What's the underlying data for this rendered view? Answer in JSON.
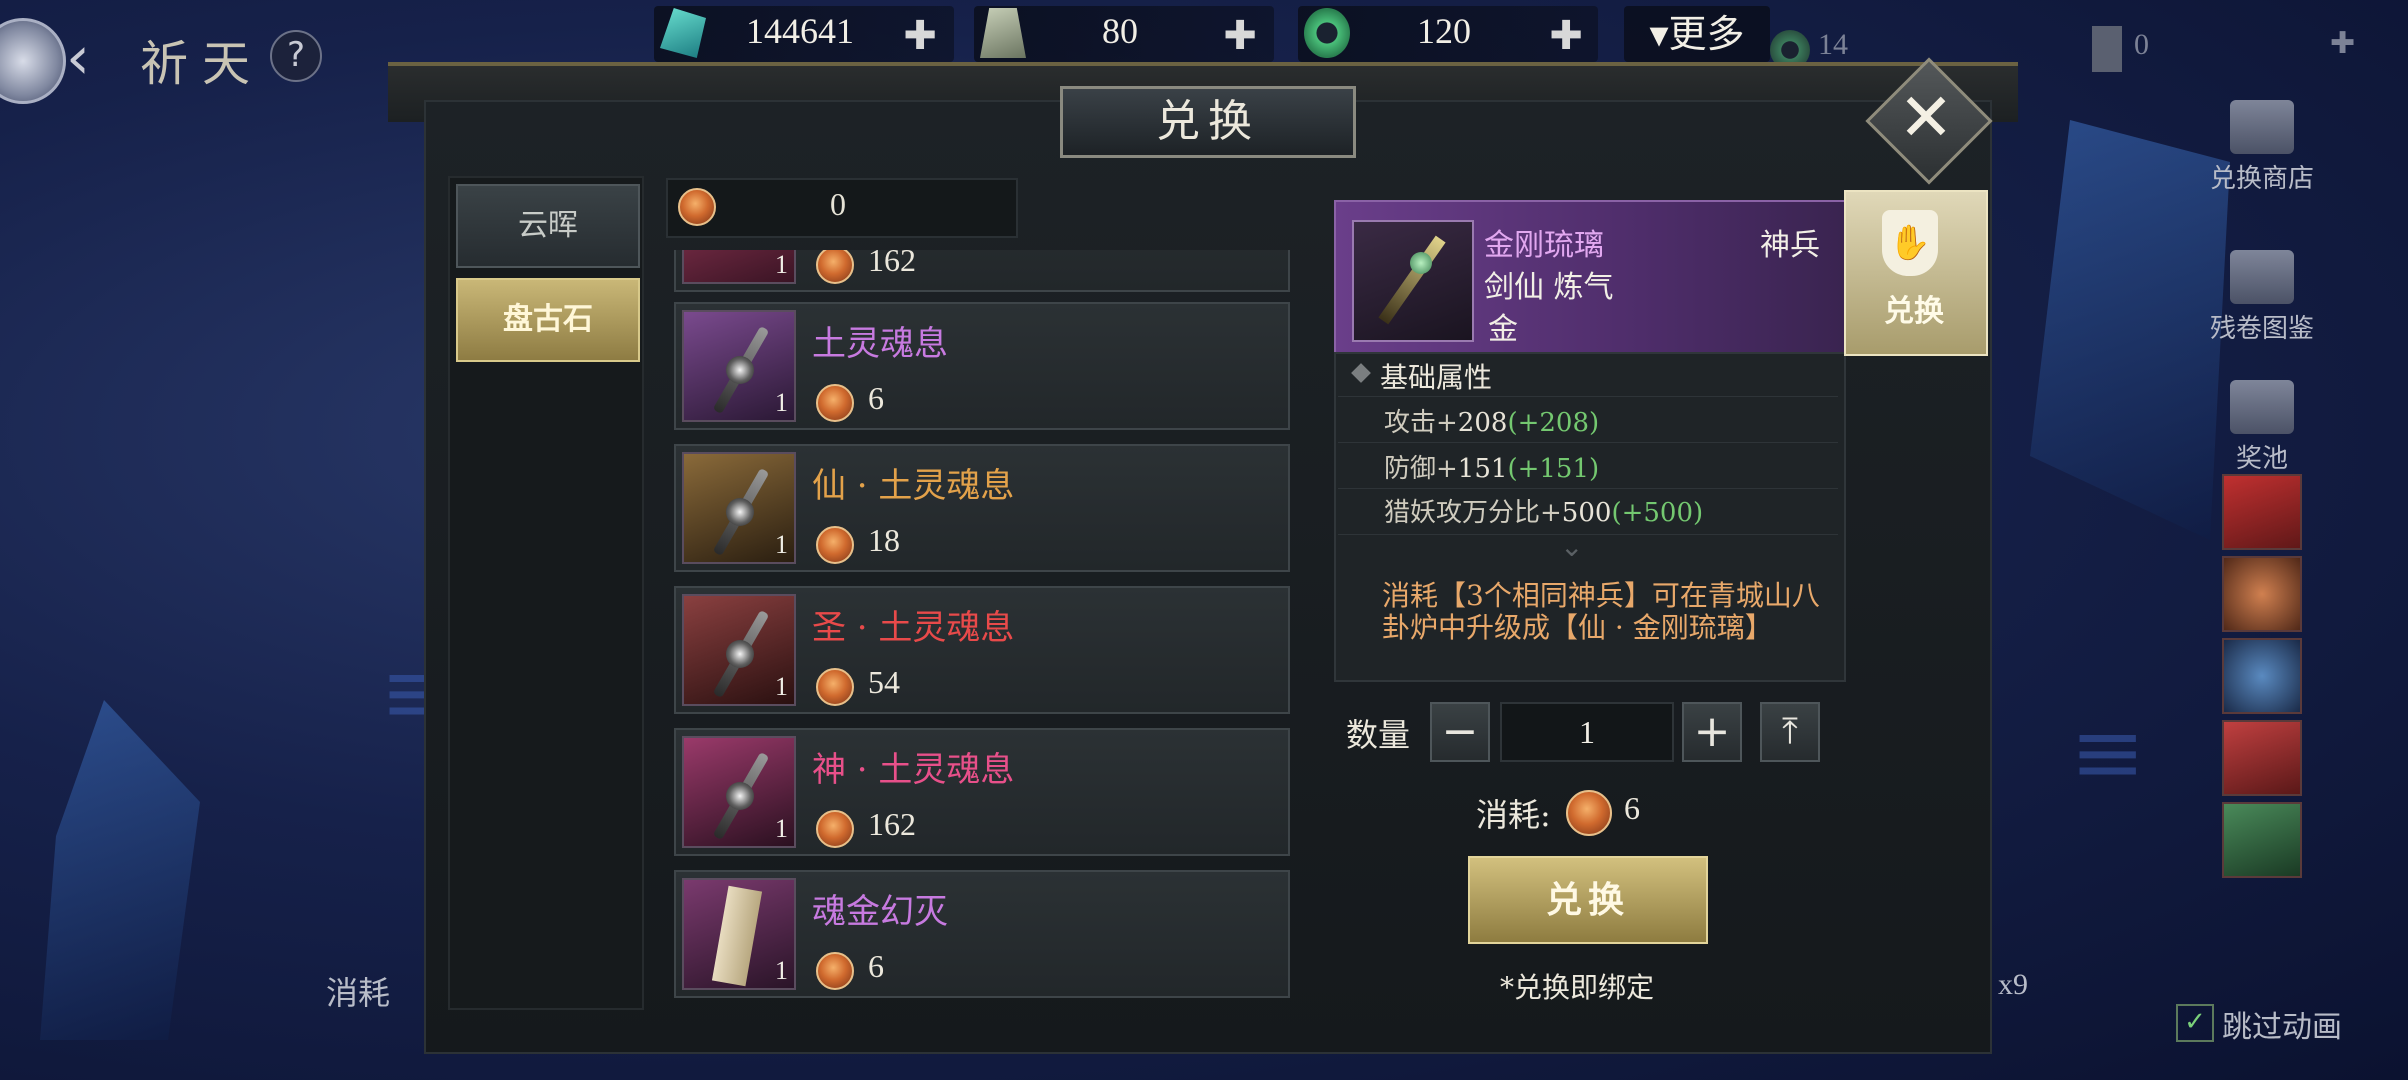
{
  "top_bar": {
    "title": "祈天",
    "help": "?",
    "resources": [
      {
        "icon": "jade-crystal-icon",
        "value": "144641"
      },
      {
        "icon": "token-card-icon",
        "value": "80"
      },
      {
        "icon": "green-ring-icon",
        "value": "120"
      }
    ],
    "more_label": "更多",
    "dim_resources": [
      "14",
      "0"
    ]
  },
  "panel": {
    "title": "兑换",
    "categories": [
      {
        "label": "云晖",
        "active": false
      },
      {
        "label": "盘古石",
        "active": true
      }
    ],
    "currency_count": "0",
    "items": [
      {
        "name": "",
        "qty": "1",
        "cost": "162",
        "name_color": "#d85a9c",
        "bg": "#7a2a4a",
        "partial": true
      },
      {
        "name": "土灵魂息",
        "qty": "1",
        "cost": "6",
        "name_color": "#c77ae0",
        "bg": "#4e2a5e"
      },
      {
        "name": "仙 · 土灵魂息",
        "qty": "1",
        "cost": "18",
        "name_color": "#e3a24a",
        "bg": "#5a4226"
      },
      {
        "name": "圣 · 土灵魂息",
        "qty": "1",
        "cost": "54",
        "name_color": "#e84a4a",
        "bg": "#5e2626"
      },
      {
        "name": "神 · 土灵魂息",
        "qty": "1",
        "cost": "162",
        "name_color": "#e8508a",
        "bg": "#6a2240"
      },
      {
        "name": "魂金幻灭",
        "qty": "1",
        "cost": "6",
        "name_color": "#c77ae0",
        "bg": "#4e2a5e"
      }
    ]
  },
  "detail": {
    "name": "金刚琉璃",
    "type": "神兵",
    "subtitle": "剑仙 炼气",
    "element": "金",
    "attr_header": "基础属性",
    "attrs": [
      {
        "label": "攻击+",
        "value": "208",
        "bonus": "(+208)"
      },
      {
        "label": "防御+",
        "value": "151",
        "bonus": "(+151)"
      },
      {
        "label": "猎妖攻万分比+",
        "value": "500",
        "bonus": "(+500)"
      }
    ],
    "description": "消耗【3个相同神兵】可在青城山八卦炉中升级成【仙 · 金刚琉璃】",
    "side_tab": "兑换",
    "qty_label": "数量",
    "qty_value": "1",
    "cost_label": "消耗:",
    "cost_value": "6",
    "exchange_label": "兑换",
    "bind_note": "*兑换即绑定"
  },
  "right_rail": {
    "items": [
      "兑换商店",
      "残卷图鉴",
      "奖池"
    ],
    "skip_label": "跳过动画",
    "x9": "x9"
  },
  "bottom": {
    "consume_label": "消耗"
  },
  "colors": {
    "gold": "#c9b777",
    "purple_header": "#6a3e8a",
    "bonus_green": "#74c870",
    "desc_orange": "#e8a86a"
  }
}
